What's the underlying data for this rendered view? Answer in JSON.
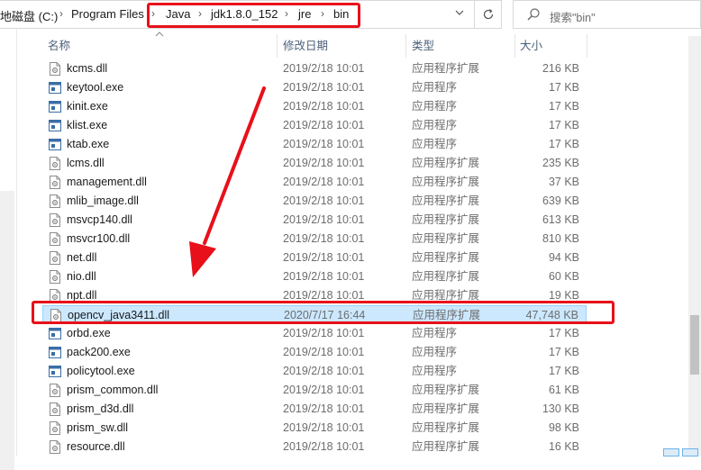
{
  "address": {
    "crumbs": [
      "地磁盘 (C:)",
      "Program Files",
      "Java",
      "jdk1.8.0_152",
      "jre",
      "bin"
    ],
    "separator": "›",
    "dropdown_icon": "chevron-down-icon",
    "refresh_icon": "refresh-icon"
  },
  "search": {
    "placeholder": "搜索\"bin\"",
    "icon": "search-icon"
  },
  "columns": {
    "name": "名称",
    "date": "修改日期",
    "type": "类型",
    "size": "大小"
  },
  "files": [
    {
      "name": "kcms.dll",
      "date": "2019/2/18 10:01",
      "type": "应用程序扩展",
      "size": "216 KB",
      "kind": "dll"
    },
    {
      "name": "keytool.exe",
      "date": "2019/2/18 10:01",
      "type": "应用程序",
      "size": "17 KB",
      "kind": "exe"
    },
    {
      "name": "kinit.exe",
      "date": "2019/2/18 10:01",
      "type": "应用程序",
      "size": "17 KB",
      "kind": "exe"
    },
    {
      "name": "klist.exe",
      "date": "2019/2/18 10:01",
      "type": "应用程序",
      "size": "17 KB",
      "kind": "exe"
    },
    {
      "name": "ktab.exe",
      "date": "2019/2/18 10:01",
      "type": "应用程序",
      "size": "17 KB",
      "kind": "exe"
    },
    {
      "name": "lcms.dll",
      "date": "2019/2/18 10:01",
      "type": "应用程序扩展",
      "size": "235 KB",
      "kind": "dll"
    },
    {
      "name": "management.dll",
      "date": "2019/2/18 10:01",
      "type": "应用程序扩展",
      "size": "37 KB",
      "kind": "dll"
    },
    {
      "name": "mlib_image.dll",
      "date": "2019/2/18 10:01",
      "type": "应用程序扩展",
      "size": "639 KB",
      "kind": "dll"
    },
    {
      "name": "msvcp140.dll",
      "date": "2019/2/18 10:01",
      "type": "应用程序扩展",
      "size": "613 KB",
      "kind": "dll"
    },
    {
      "name": "msvcr100.dll",
      "date": "2019/2/18 10:01",
      "type": "应用程序扩展",
      "size": "810 KB",
      "kind": "dll"
    },
    {
      "name": "net.dll",
      "date": "2019/2/18 10:01",
      "type": "应用程序扩展",
      "size": "94 KB",
      "kind": "dll"
    },
    {
      "name": "nio.dll",
      "date": "2019/2/18 10:01",
      "type": "应用程序扩展",
      "size": "60 KB",
      "kind": "dll"
    },
    {
      "name": "npt.dll",
      "date": "2019/2/18 10:01",
      "type": "应用程序扩展",
      "size": "19 KB",
      "kind": "dll"
    },
    {
      "name": "opencv_java3411.dll",
      "date": "2020/7/17 16:44",
      "type": "应用程序扩展",
      "size": "47,748 KB",
      "kind": "dll",
      "selected": true
    },
    {
      "name": "orbd.exe",
      "date": "2019/2/18 10:01",
      "type": "应用程序",
      "size": "17 KB",
      "kind": "exe"
    },
    {
      "name": "pack200.exe",
      "date": "2019/2/18 10:01",
      "type": "应用程序",
      "size": "17 KB",
      "kind": "exe"
    },
    {
      "name": "policytool.exe",
      "date": "2019/2/18 10:01",
      "type": "应用程序",
      "size": "17 KB",
      "kind": "exe"
    },
    {
      "name": "prism_common.dll",
      "date": "2019/2/18 10:01",
      "type": "应用程序扩展",
      "size": "61 KB",
      "kind": "dll"
    },
    {
      "name": "prism_d3d.dll",
      "date": "2019/2/18 10:01",
      "type": "应用程序扩展",
      "size": "130 KB",
      "kind": "dll"
    },
    {
      "name": "prism_sw.dll",
      "date": "2019/2/18 10:01",
      "type": "应用程序扩展",
      "size": "98 KB",
      "kind": "dll"
    },
    {
      "name": "resource.dll",
      "date": "2019/2/18 10:01",
      "type": "应用程序扩展",
      "size": "16 KB",
      "kind": "dll"
    }
  ],
  "colors": {
    "highlight": "#e8101a",
    "selection": "#cce8ff",
    "selection_border": "#99d1ff",
    "header_text": "#4c607a"
  }
}
